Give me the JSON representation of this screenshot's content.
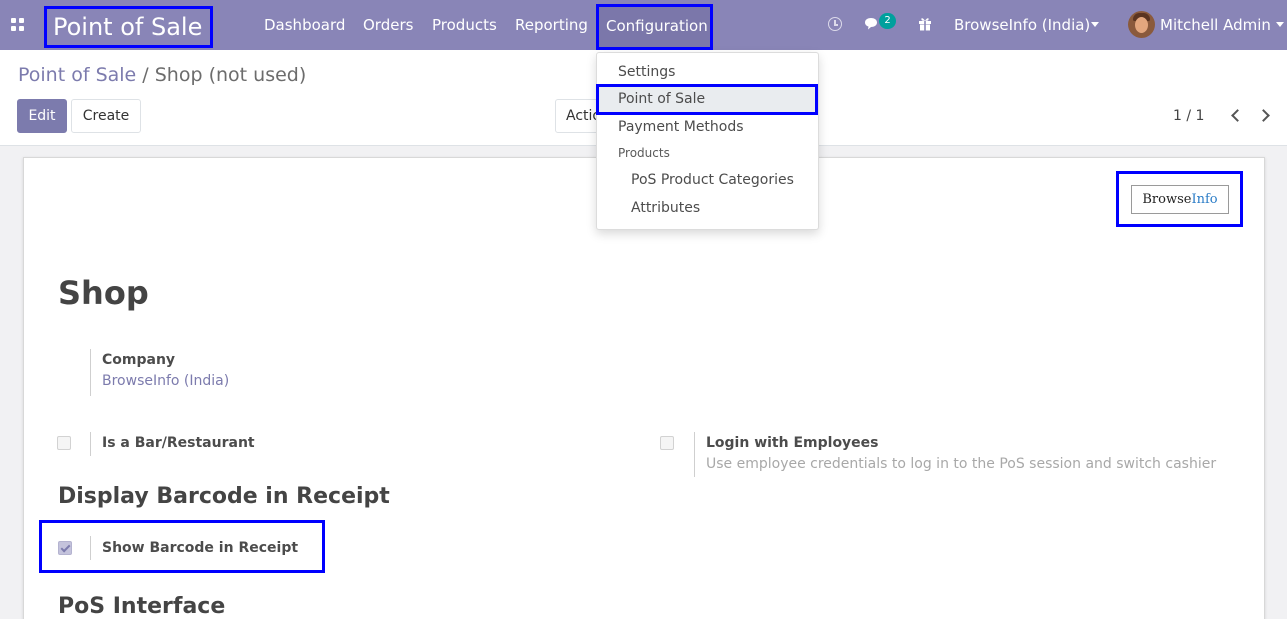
{
  "navbar": {
    "brand": "Point of Sale",
    "menu": [
      "Dashboard",
      "Orders",
      "Products",
      "Reporting",
      "Configuration"
    ],
    "chat_count": "2",
    "company": "BrowseInfo (India)",
    "user": "Mitchell Admin"
  },
  "control_panel": {
    "breadcrumb_parent": "Point of Sale",
    "breadcrumb_separator": "/",
    "breadcrumb_current": "Shop (not used)",
    "edit_label": "Edit",
    "create_label": "Create",
    "action_label": "Action",
    "pager": "1 / 1"
  },
  "dropdown": {
    "items": [
      "Settings",
      "Point of Sale",
      "Payment Methods"
    ],
    "header": "Products",
    "sub_items": [
      "PoS Product Categories",
      "Attributes"
    ]
  },
  "form": {
    "logo_text_main": "Browse",
    "logo_text_accent": "Info",
    "title": "Shop",
    "company_label": "Company",
    "company_value": "BrowseInfo (India)",
    "bar_restaurant_label": "Is a Bar/Restaurant",
    "bar_restaurant_checked": false,
    "login_employees_label": "Login with Employees",
    "login_employees_help": "Use employee credentials to log in to the PoS session and switch cashier",
    "login_employees_checked": false,
    "barcode_section": "Display Barcode in Receipt",
    "show_barcode_label": "Show Barcode in Receipt",
    "show_barcode_checked": true,
    "interface_section": "PoS Interface"
  },
  "colors": {
    "navbar": "#8985b7",
    "accent": "#7c7bad",
    "highlight_border": "#0000ff",
    "badge": "#00a09d"
  }
}
